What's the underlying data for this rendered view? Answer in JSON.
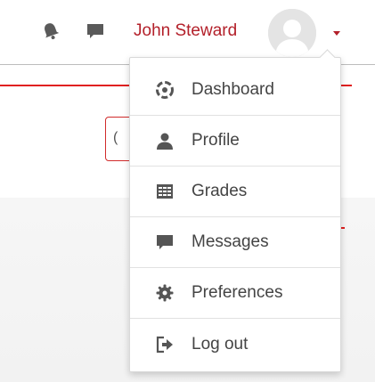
{
  "header": {
    "user_name": "John Steward",
    "icons": [
      "bell-icon",
      "chat-icon",
      "avatar",
      "caret-down-icon"
    ]
  },
  "menu": {
    "items": [
      {
        "label": "Dashboard",
        "icon": "dashboard-icon"
      },
      {
        "label": "Profile",
        "icon": "user-icon"
      },
      {
        "label": "Grades",
        "icon": "grades-table-icon"
      },
      {
        "label": "Messages",
        "icon": "messages-icon"
      },
      {
        "label": "Preferences",
        "icon": "gear-icon"
      },
      {
        "label": "Log out",
        "icon": "logout-icon"
      }
    ]
  },
  "colors": {
    "accent": "#b3202a",
    "icon_gray": "#555555",
    "text": "#444444"
  }
}
